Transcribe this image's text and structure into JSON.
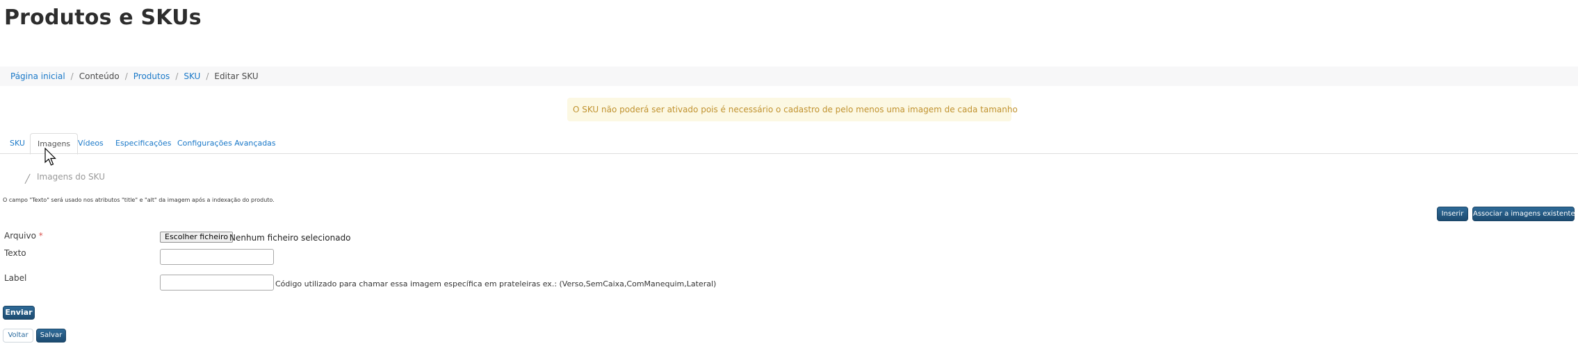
{
  "page": {
    "title": "Produtos e SKUs"
  },
  "breadcrumb": {
    "home": "Página inicial",
    "content": "Conteúdo",
    "products": "Produtos",
    "sku": "SKU",
    "current": "Editar SKU",
    "separator": "/"
  },
  "alert": {
    "message": "O SKU não poderá ser ativado pois é necessário o cadastro de pelo menos uma imagem de cada tamanho"
  },
  "tabs": [
    {
      "label": "SKU"
    },
    {
      "label": "Imagens"
    },
    {
      "label": "Vídeos"
    },
    {
      "label": "Especificações"
    },
    {
      "label": "Configurações Avançadas"
    }
  ],
  "section": {
    "icon": "image-icon",
    "title": "Imagens do SKU"
  },
  "hint": "O campo \"Texto\" será usado nos atributos \"title\" e \"alt\" da imagem após a indexação do produto.",
  "actions": {
    "insert": "Inserir",
    "associate": "Associar a imagens existentes"
  },
  "form": {
    "file_label": "Arquivo",
    "required_mark": "*",
    "file_button": "Escolher ficheiro",
    "file_status": "Nenhum ficheiro selecionado",
    "text_label": "Texto",
    "text_value": "",
    "label_label": "Label",
    "label_value": "",
    "label_help": "Código utilizado para chamar essa imagem específica em prateleiras ex.: (Verso,SemCaixa,ComManequim,Lateral)",
    "send": "Enviar"
  },
  "footer": {
    "back": "Voltar",
    "save": "Salvar"
  },
  "colors": {
    "link": "#1978c8",
    "primary": "#23527c",
    "alert_bg": "#fcf8e3",
    "alert_text": "#c0922f"
  }
}
